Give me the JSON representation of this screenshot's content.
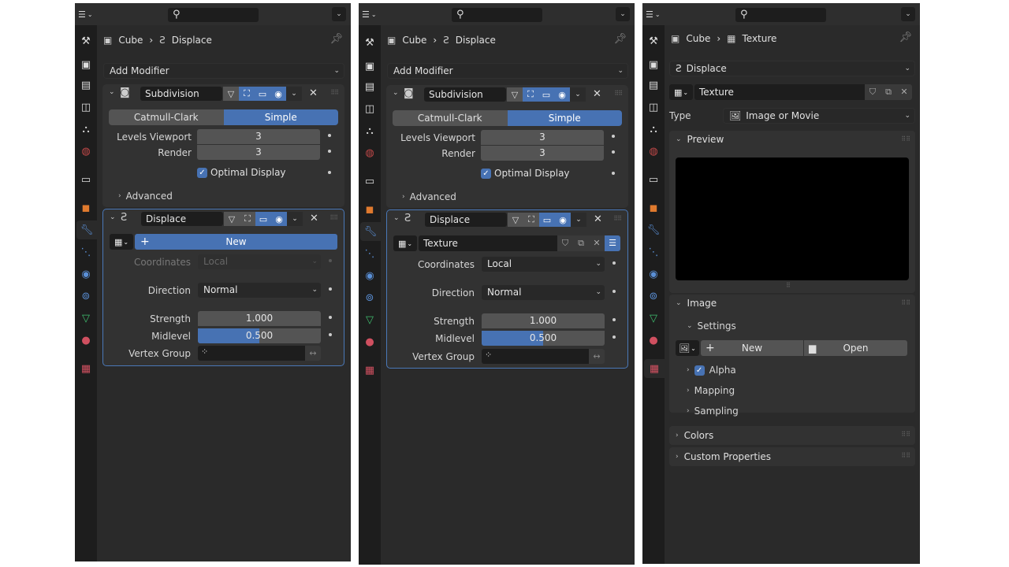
{
  "panels": [
    {
      "breadcrumb": {
        "object": "Cube",
        "item": "Displace"
      },
      "add_modifier": "Add Modifier",
      "modifiers": {
        "subdivision": {
          "name": "Subdivision",
          "mode_options": [
            "Catmull-Clark",
            "Simple"
          ],
          "mode_selected": "Simple",
          "levels_viewport_label": "Levels Viewport",
          "levels_viewport": "3",
          "render_label": "Render",
          "render": "3",
          "optimal_display_label": "Optimal Display",
          "optimal_display": true,
          "advanced_label": "Advanced"
        },
        "displace": {
          "name": "Displace",
          "texture_new_label": "New",
          "coordinates_label": "Coordinates",
          "coordinates": "Local",
          "direction_label": "Direction",
          "direction": "Normal",
          "strength_label": "Strength",
          "strength": "1.000",
          "midlevel_label": "Midlevel",
          "midlevel": "0.500",
          "midlevel_fraction": 0.5,
          "vertex_group_label": "Vertex Group",
          "vertex_group": ""
        }
      }
    },
    {
      "breadcrumb": {
        "object": "Cube",
        "item": "Displace"
      },
      "add_modifier": "Add Modifier",
      "modifiers": {
        "subdivision": {
          "name": "Subdivision",
          "mode_options": [
            "Catmull-Clark",
            "Simple"
          ],
          "mode_selected": "Simple",
          "levels_viewport_label": "Levels Viewport",
          "levels_viewport": "3",
          "render_label": "Render",
          "render": "3",
          "optimal_display_label": "Optimal Display",
          "optimal_display": true,
          "advanced_label": "Advanced"
        },
        "displace": {
          "name": "Displace",
          "texture_name": "Texture",
          "coordinates_label": "Coordinates",
          "coordinates": "Local",
          "direction_label": "Direction",
          "direction": "Normal",
          "strength_label": "Strength",
          "strength": "1.000",
          "midlevel_label": "Midlevel",
          "midlevel": "0.500",
          "midlevel_fraction": 0.5,
          "vertex_group_label": "Vertex Group",
          "vertex_group": ""
        }
      }
    },
    {
      "breadcrumb": {
        "object": "Cube",
        "item": "Texture"
      },
      "modifier_select": "Displace",
      "texture_name": "Texture",
      "type_label": "Type",
      "type_value": "Image or Movie",
      "sections": {
        "preview": "Preview",
        "image": "Image",
        "settings": "Settings",
        "new_label": "New",
        "open_label": "Open",
        "alpha_label": "Alpha",
        "alpha": true,
        "mapping": "Mapping",
        "sampling": "Sampling",
        "colors": "Colors",
        "custom_properties": "Custom Properties"
      }
    }
  ],
  "icons": {
    "tool": "🔧",
    "render": "📷",
    "output": "🖨",
    "view_layer": "🖼",
    "scene": "🎭",
    "world": "🌐",
    "collection": "🗃",
    "object": "■",
    "modifier": "🔧",
    "particles": "⋰",
    "physics": "◉",
    "constraints": "⊚",
    "data": "▽",
    "material": "●",
    "texture": "▦"
  },
  "colors": {
    "accent": "#4772b3",
    "panel_bg": "#2a2a2a",
    "tab_bg": "#1d1d1d"
  }
}
